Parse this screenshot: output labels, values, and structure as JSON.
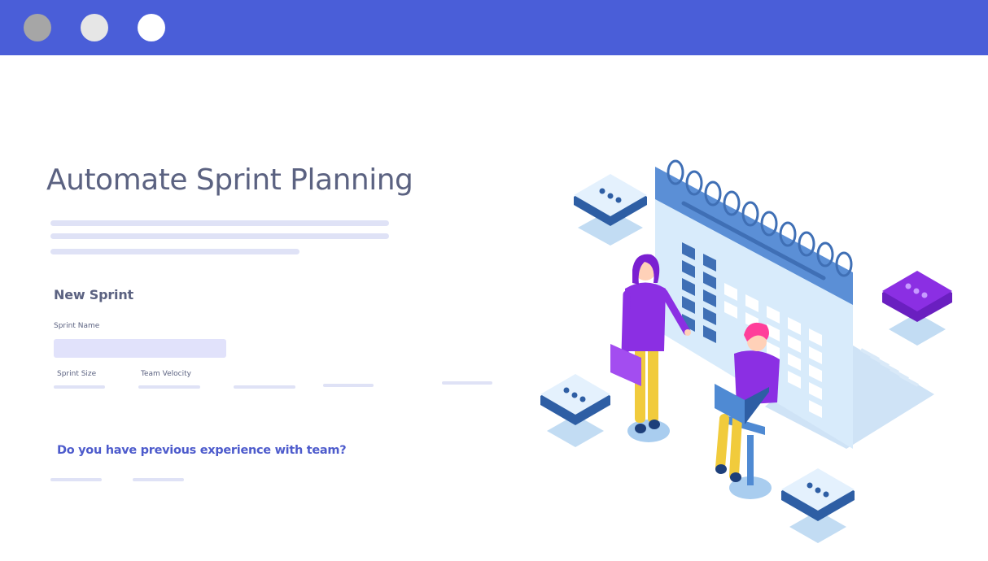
{
  "window": {
    "controls": [
      {
        "name": "window-control-1",
        "color": "#a6a6a6"
      },
      {
        "name": "window-control-2",
        "color": "#e6e6e6"
      },
      {
        "name": "window-control-3",
        "color": "#ffffff"
      }
    ]
  },
  "hero": {
    "title": "Automate Sprint Planning"
  },
  "form": {
    "section_title": "New Sprint",
    "sprint_name_label": "Sprint Name",
    "sprint_name_value": "",
    "sprint_size_label": "Sprint Size",
    "team_velocity_label": "Team Velocity",
    "question": "Do you have previous experience with team?"
  },
  "colors": {
    "topbar": "#4a5ed8",
    "title_text": "#5b6281",
    "question_text": "#4d5bcc",
    "placeholder_line": "#dfe2f6",
    "input_fill": "#e1e2fb",
    "calendar_blue": "#5b8fd6",
    "calendar_light": "#d8ebfb",
    "accent_purple": "#8b2fe3"
  },
  "illustration": {
    "description_icon": "calendar-icon"
  }
}
